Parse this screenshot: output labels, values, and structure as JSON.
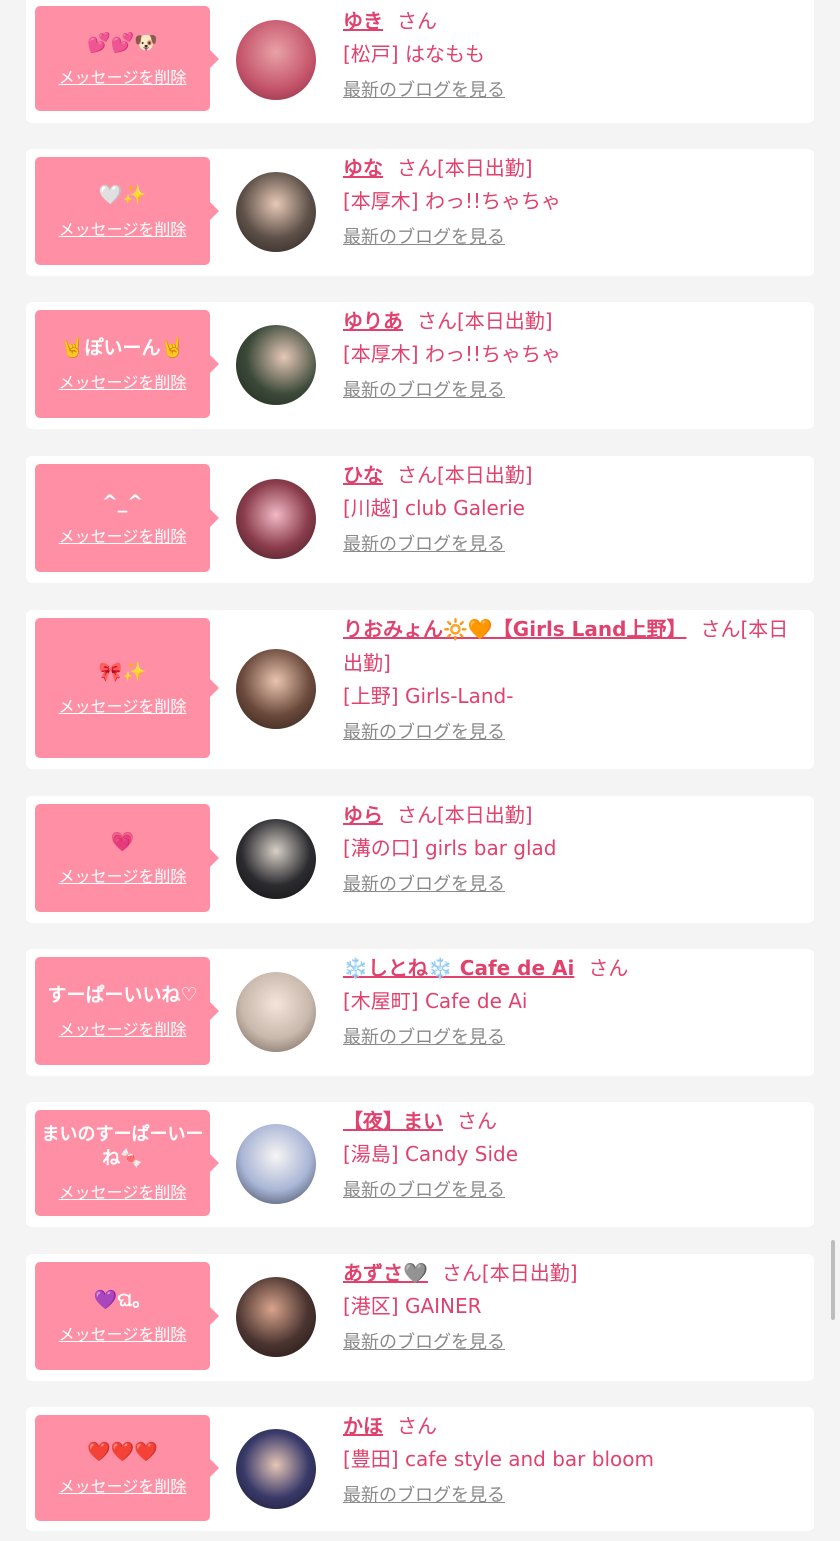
{
  "labels": {
    "delete": "メッセージを削除",
    "san": "さん",
    "blog": "最新のブログを見る"
  },
  "items": [
    {
      "bubble": "💕💕🐶",
      "name": "ゆき",
      "status": "",
      "shop": "[松戸] はなもも",
      "avatar_color": "#c4536a"
    },
    {
      "bubble": "🤍✨",
      "name": "ゆな",
      "status": "[本日出勤]",
      "shop": "[本厚木] わっ!!ちゃちゃ",
      "avatar_color": "#5d5048"
    },
    {
      "bubble": "🤘ぽいーん🤘",
      "name": "ゆりあ",
      "status": "[本日出勤]",
      "shop": "[本厚木] わっ!!ちゃちゃ",
      "avatar_color": "#3c4a3a"
    },
    {
      "bubble": "^_^",
      "name": "ひな",
      "status": "[本日出勤]",
      "shop": "[川越] club Galerie",
      "avatar_color": "#8a3c4c"
    },
    {
      "bubble": "🎀✨",
      "name": "りおみょん🔆🧡【Girls Land上野】",
      "status": "[本日出勤]",
      "shop": "[上野] Girls-Land-",
      "avatar_color": "#6b4a3c"
    },
    {
      "bubble": "💗",
      "name": "ゆら",
      "status": "[本日出勤]",
      "shop": "[溝の口] girls bar glad",
      "avatar_color": "#2c2c30"
    },
    {
      "bubble": "すーぱーいいね♡",
      "name": "❄️しとね❄️ Cafe de Ai",
      "status": "",
      "shop": "[木屋町] Cafe de Ai",
      "avatar_color": "#c9b8ac"
    },
    {
      "bubble": "まいのすーぱーいーね🍬",
      "name": "【夜】まい",
      "status": "",
      "shop": "[湯島] Candy Side",
      "avatar_color": "#aab6d6"
    },
    {
      "bubble": "💜ଘ。",
      "name": "あずさ🩶",
      "status": "[本日出勤]",
      "shop": "[港区] GAINER",
      "avatar_color": "#4a3430"
    },
    {
      "bubble": "❤️❤️❤️",
      "name": "かほ",
      "status": "",
      "shop": "[豊田] cafe style and bar bloom",
      "avatar_color": "#3a3a6a"
    }
  ]
}
